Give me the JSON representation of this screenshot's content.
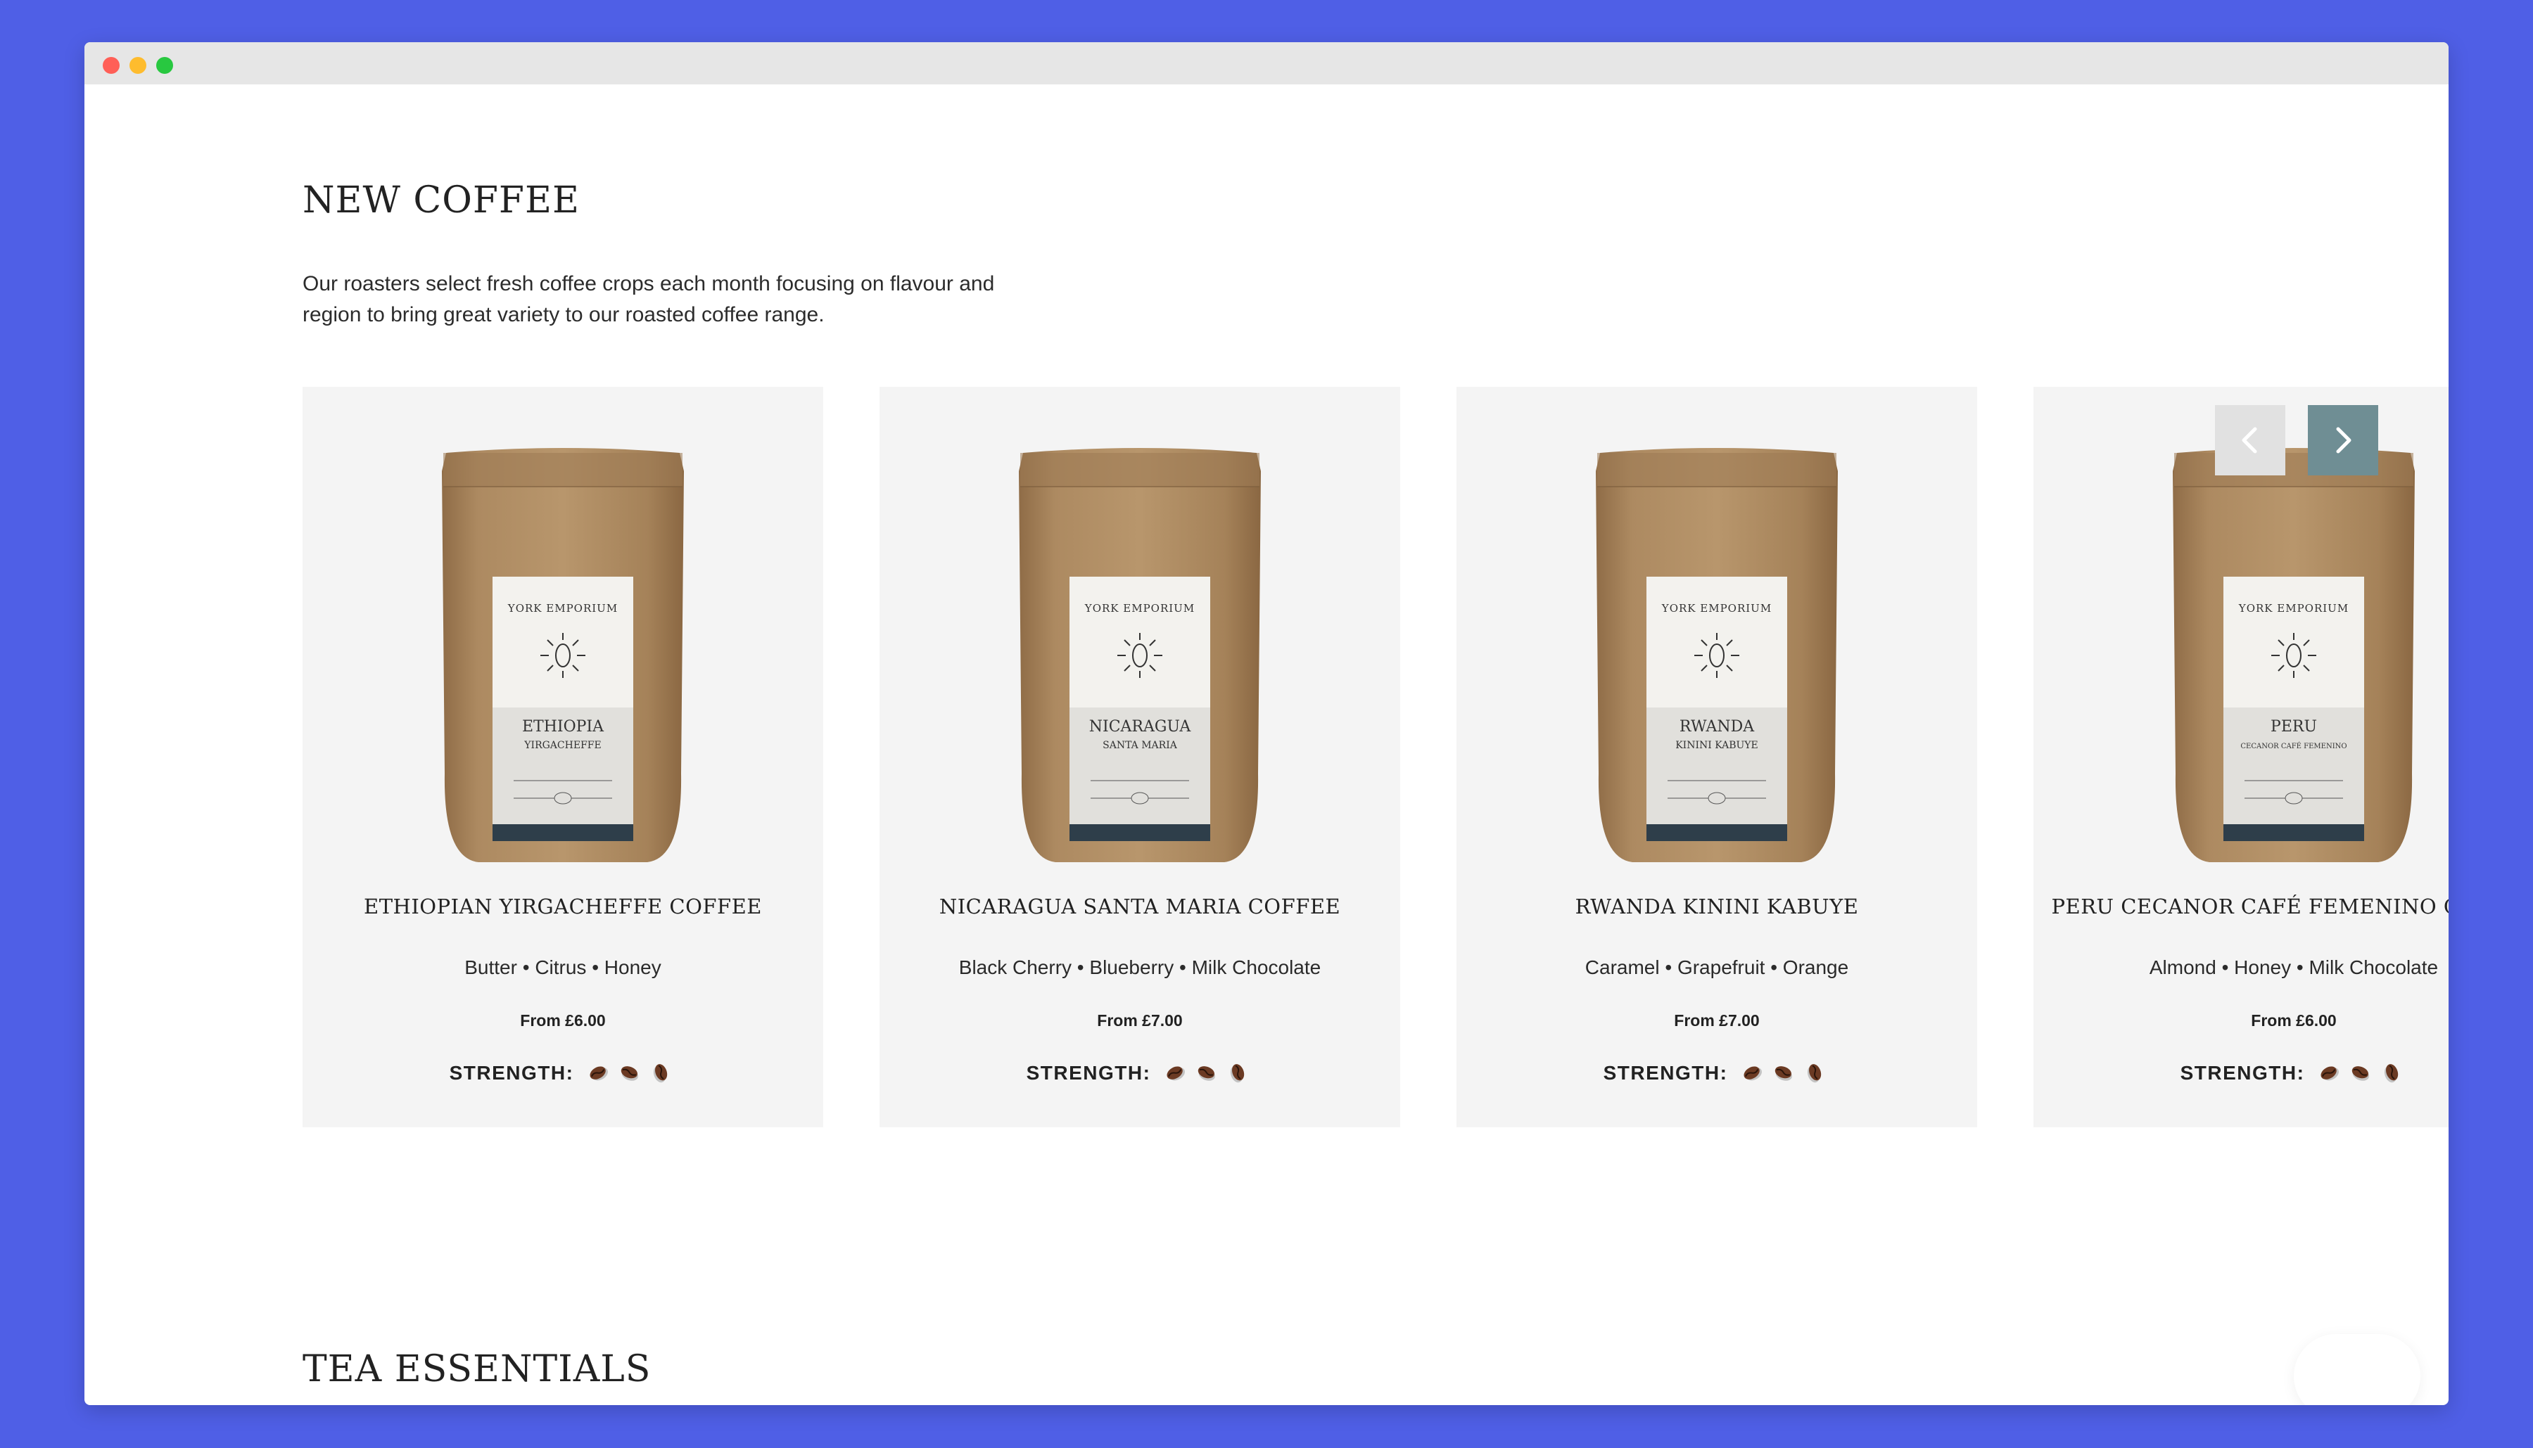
{
  "sections": {
    "new_coffee": {
      "title": "NEW COFFEE",
      "intro": "Our roasters select fresh coffee crops each month focusing on flavour and region to bring great variety to our roasted coffee range."
    },
    "tea": {
      "title": "TEA ESSENTIALS"
    }
  },
  "strength_label": "STRENGTH:",
  "brand": "YORK EMPORIUM",
  "products": [
    {
      "name": "ETHIOPIAN YIRGACHEFFE COFFEE",
      "notes": "Butter • Citrus • Honey",
      "price": "From £6.00",
      "label_title": "ETHIOPIA",
      "label_sub": "YIRGACHEFFE",
      "strength_of_3": 3
    },
    {
      "name": "NICARAGUA SANTA MARIA COFFEE",
      "notes": "Black Cherry • Blueberry • Milk Chocolate",
      "price": "From £7.00",
      "label_title": "NICARAGUA",
      "label_sub": "SANTA MARIA",
      "strength_of_3": 3
    },
    {
      "name": "RWANDA KININI KABUYE",
      "notes": "Caramel • Grapefruit • Orange",
      "price": "From £7.00",
      "label_title": "RWANDA",
      "label_sub": "KININI KABUYE",
      "strength_of_3": 3
    },
    {
      "name": "PERU CECANOR CAFÉ FEMENINO COFFEE",
      "notes": "Almond • Honey • Milk Chocolate",
      "price": "From £6.00",
      "label_title": "PERU",
      "label_sub": "CECANOR CAFÉ FEMENINO",
      "strength_of_3": 3
    }
  ],
  "colors": {
    "page_background": "#4f5fe6",
    "card_background": "#f4f4f4",
    "next_button": "#6f8e94",
    "prev_button": "#e1e1e1",
    "kraft_bag": "#a9845c"
  },
  "icons": {
    "prev": "chevron-left-icon",
    "next": "chevron-right-icon",
    "strength": "coffee-bean-icon"
  }
}
